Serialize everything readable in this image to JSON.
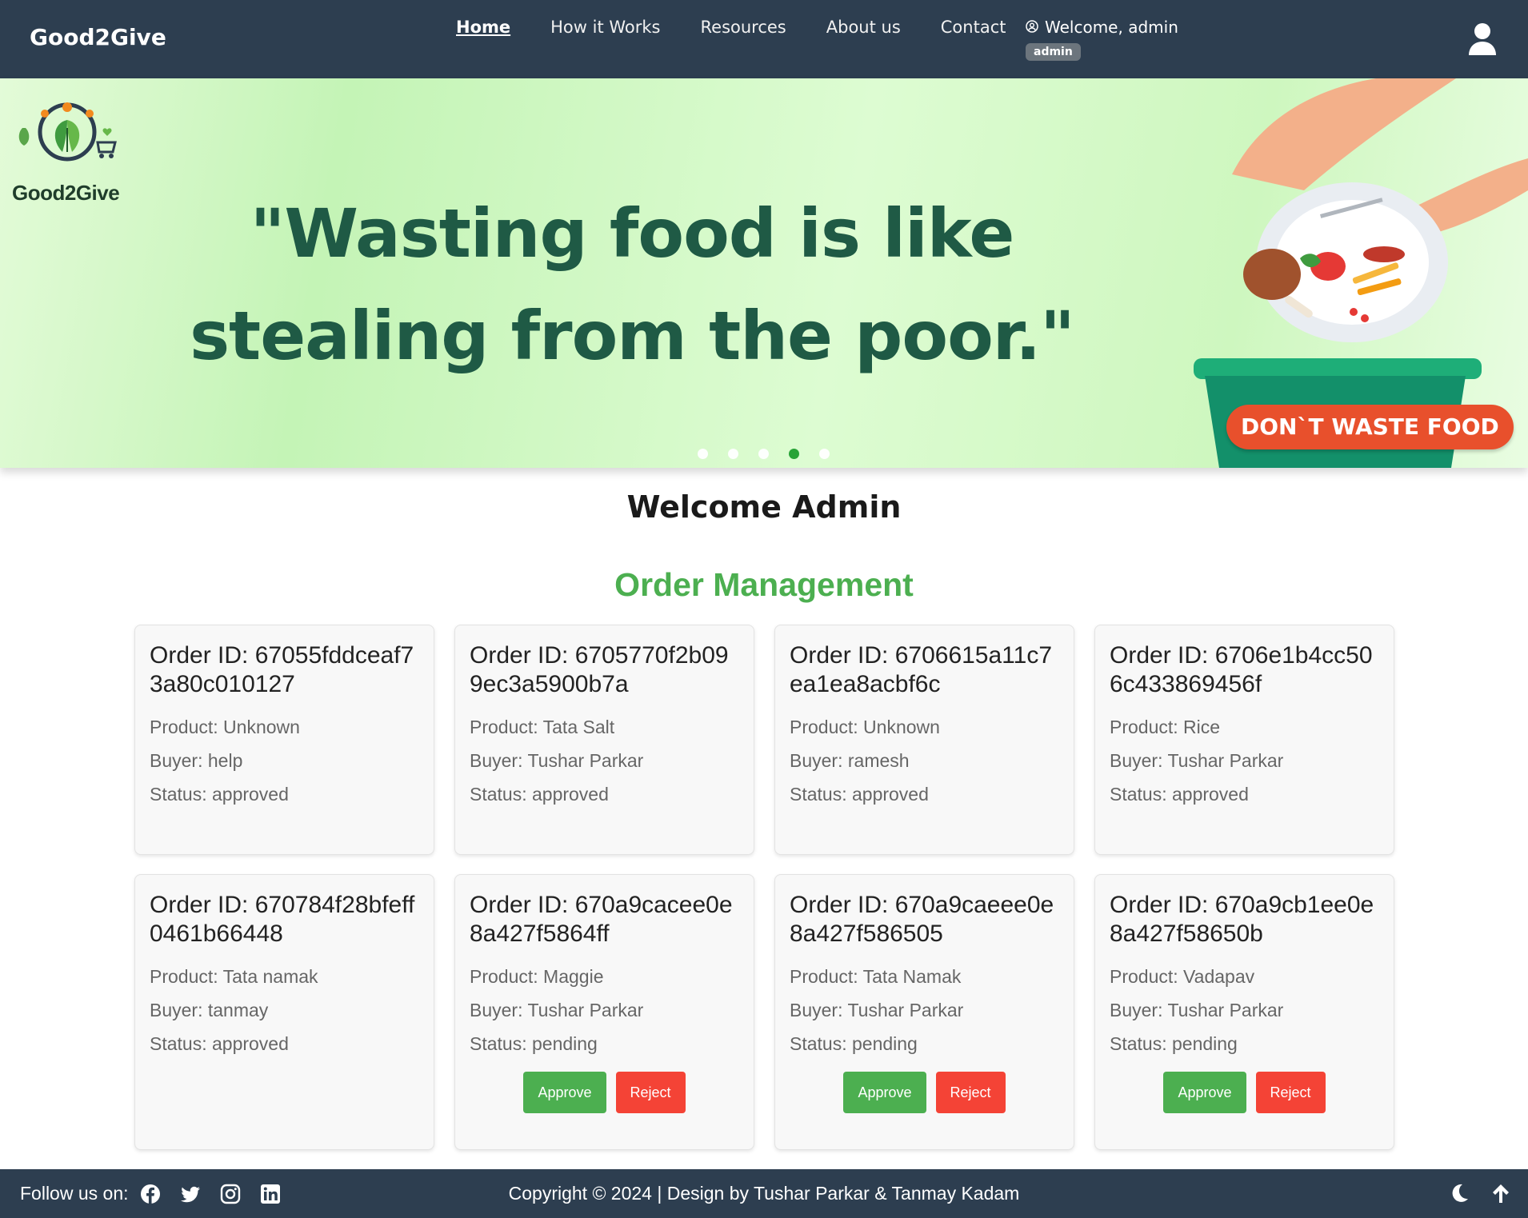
{
  "nav": {
    "brand": "Good2Give",
    "links": [
      "Home",
      "How it Works",
      "Resources",
      "About us",
      "Contact"
    ],
    "welcome": "Welcome, admin",
    "role_badge": "admin"
  },
  "hero": {
    "logo_text": "Good2Give",
    "quote_line1": "\"Wasting food is like",
    "quote_line2": "stealing from the poor.\"",
    "art_label": "DON`T WASTE FOOD",
    "slide_count": 5,
    "active_slide": 4
  },
  "main": {
    "welcome_heading": "Welcome Admin",
    "section_title": "Order Management",
    "order_label": "Order ID:",
    "product_label": "Product: ",
    "buyer_label": "Buyer: ",
    "status_label": "Status: ",
    "approve_label": "Approve",
    "reject_label": "Reject",
    "orders": [
      {
        "id": "67055fddceaf73a80c010127",
        "product": "Unknown",
        "buyer": "help",
        "status": "approved"
      },
      {
        "id": "6705770f2b099ec3a5900b7a",
        "product": "Tata Salt",
        "buyer": "Tushar Parkar",
        "status": "approved"
      },
      {
        "id": "6706615a11c7ea1ea8acbf6c",
        "product": "Unknown",
        "buyer": "ramesh",
        "status": "approved"
      },
      {
        "id": "6706e1b4cc506c433869456f",
        "product": "Rice",
        "buyer": "Tushar Parkar",
        "status": "approved"
      },
      {
        "id": "670784f28bfeff0461b66448",
        "product": "Tata namak",
        "buyer": "tanmay",
        "status": "approved"
      },
      {
        "id": "670a9cacee0e8a427f5864ff",
        "product": "Maggie",
        "buyer": "Tushar Parkar",
        "status": "pending"
      },
      {
        "id": "670a9caeee0e8a427f586505",
        "product": "Tata Namak",
        "buyer": "Tushar Parkar",
        "status": "pending"
      },
      {
        "id": "670a9cb1ee0e8a427f58650b",
        "product": "Vadapav",
        "buyer": "Tushar Parkar",
        "status": "pending"
      }
    ]
  },
  "footer": {
    "follow": "Follow us on:",
    "social_icons": [
      "facebook-icon",
      "twitter-icon",
      "instagram-icon",
      "linkedin-icon"
    ],
    "copyright": "Copyright © 2024 | Design by Tushar Parkar & Tanmay Kadam"
  },
  "colors": {
    "nav_bg": "#2d3e50",
    "accent_green": "#4caf50",
    "reject_red": "#f44336",
    "quote_green": "#1f5a45",
    "active_dot": "#1e9e2e"
  }
}
